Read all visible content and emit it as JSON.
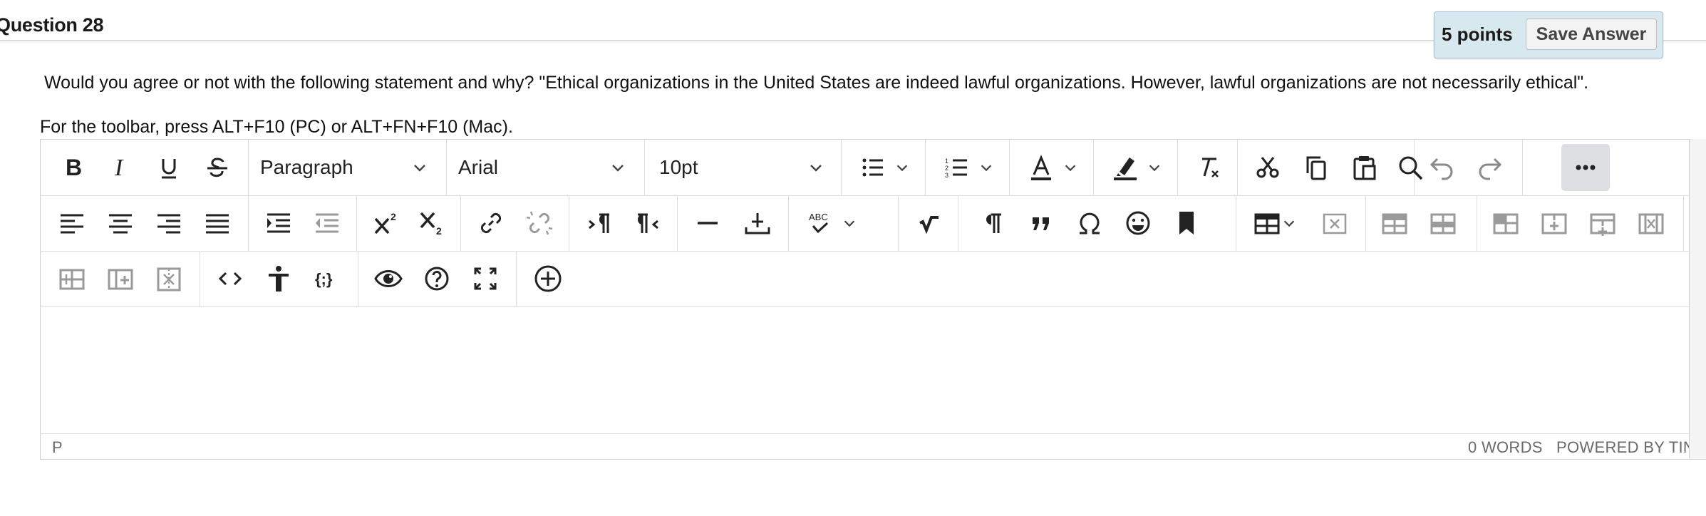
{
  "question": {
    "title": "Question 28",
    "points": "5 points",
    "save_label": "Save Answer"
  },
  "prompt": "Would you agree or not with the following statement and why?  \"Ethical organizations in the United States are indeed lawful organizations. However, lawful organizations are not necessarily ethical\".",
  "toolbar_hint": "For the toolbar, press ALT+F10 (PC) or ALT+FN+F10 (Mac).",
  "toolbar": {
    "block_format": "Paragraph",
    "font_family": "Arial",
    "font_size": "10pt",
    "row1_icons": [
      "bold-icon",
      "italic-icon",
      "underline-icon",
      "strikethrough-icon",
      "bullet-list-icon",
      "numbered-list-icon",
      "text-color-icon",
      "highlight-icon",
      "clear-formatting-icon",
      "cut-icon",
      "copy-icon",
      "paste-icon",
      "find-icon",
      "undo-icon",
      "redo-icon",
      "more-icon"
    ],
    "row2_icons": [
      "align-left-icon",
      "align-center-icon",
      "align-right-icon",
      "justify-icon",
      "indent-icon",
      "outdent-icon",
      "superscript-icon",
      "subscript-icon",
      "link-icon",
      "unlink-icon",
      "ltr-icon",
      "rtl-icon",
      "horizontal-line-icon",
      "insert-icon",
      "spellcheck-icon",
      "equation-icon",
      "paragraph-mark-icon",
      "blockquote-icon",
      "omega-icon",
      "emoji-icon",
      "bookmark-icon",
      "table-icon",
      "delete-table-icon",
      "row-before-icon",
      "row-after-icon",
      "delete-row-icon",
      "col-before-icon",
      "col-after-icon",
      "delete-col-icon"
    ],
    "row3_icons": [
      "split-cell-icon",
      "merge-cell-icon",
      "delete-cell-icon",
      "code-icon",
      "accessibility-icon",
      "source-code-icon",
      "preview-icon",
      "help-icon",
      "fullscreen-icon",
      "add-content-icon"
    ],
    "spellcheck_label": "ABC"
  },
  "editor": {
    "content": ""
  },
  "statusbar": {
    "path": "P",
    "word_count": "0 WORDS",
    "powered_by": "POWERED BY TINY"
  }
}
